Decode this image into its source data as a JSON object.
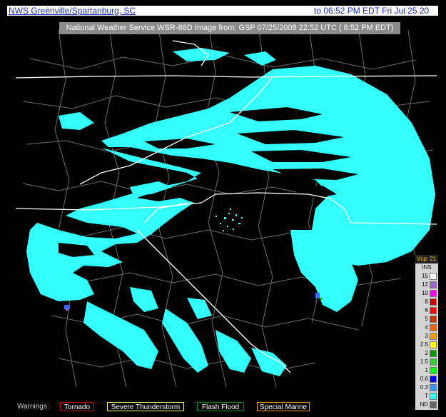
{
  "top_bar": {
    "title": "NWS Greenville/Spartanburg, SC",
    "time": "to 06:52 PM EDT Fri Jul 25 20"
  },
  "header_strip": {
    "text": "National Weather Service WSR-88D Image from: GSP 07/25/2008 22:52 UTC ( 6:52 PM EDT)"
  },
  "legend": {
    "title": "Vcp: 21",
    "units": "INS",
    "rows": [
      {
        "label": "15",
        "color": "#ffffff"
      },
      {
        "label": "12",
        "color": "#9966cc"
      },
      {
        "label": "10",
        "color": "#ff00ff"
      },
      {
        "label": "8",
        "color": "#cc0000"
      },
      {
        "label": "6",
        "color": "#ff0000"
      },
      {
        "label": "5",
        "color": "#cc3300"
      },
      {
        "label": "4",
        "color": "#ff6600"
      },
      {
        "label": "3",
        "color": "#ff9900"
      },
      {
        "label": "2.5",
        "color": "#ffff00"
      },
      {
        "label": "2",
        "color": "#009900"
      },
      {
        "label": "1.5",
        "color": "#33cc33"
      },
      {
        "label": "1",
        "color": "#00ff00"
      },
      {
        "label": "0.6",
        "color": "#0000ff"
      },
      {
        "label": "0.3",
        "color": "#3399ff"
      },
      {
        "label": "T",
        "color": "#33ffff"
      },
      {
        "label": "ND",
        "color": "#666666"
      }
    ]
  },
  "warnings": {
    "label": "Warnings:",
    "items": [
      {
        "label": "Tornado",
        "color": "#cc0000"
      },
      {
        "label": "Severe Thunderstorm",
        "color": "#ffff66"
      },
      {
        "label": "Flash Flood",
        "color": "#009900"
      },
      {
        "label": "Special Marine",
        "color": "#ff9900"
      }
    ]
  },
  "colors": {
    "precip": "#33ffff",
    "border_lines": "#ffffff",
    "county_lines": "#777777",
    "heavy_precip": "#3366ff"
  }
}
